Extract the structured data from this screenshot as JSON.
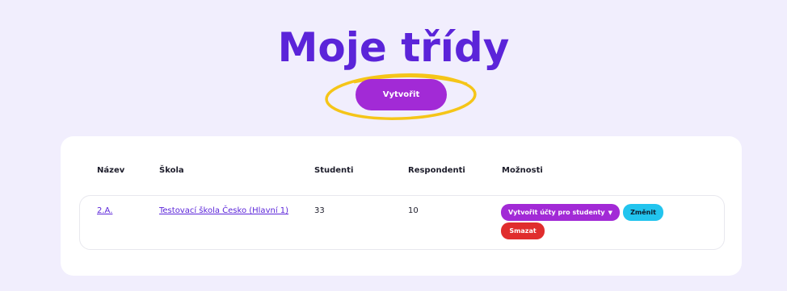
{
  "header": {
    "title": "Moje třídy",
    "create_label": "Vytvořit"
  },
  "table": {
    "columns": [
      "Název",
      "Škola",
      "Studenti",
      "Respondenti",
      "Možnosti"
    ],
    "rows": [
      {
        "name": "2.A.",
        "school": "Testovací škola Česko (Hlavní 1)",
        "students": "33",
        "respondents": "10",
        "actions": {
          "create_accounts": "Vytvořit účty pro studenty",
          "edit": "Změnit",
          "delete": "Smazat"
        }
      }
    ]
  },
  "colors": {
    "background": "#f1eefd",
    "title": "#5b24d9",
    "primary": "#a22ad6",
    "highlight_ring": "#f5c518",
    "edit": "#22c4ee",
    "delete": "#e02d2d"
  }
}
